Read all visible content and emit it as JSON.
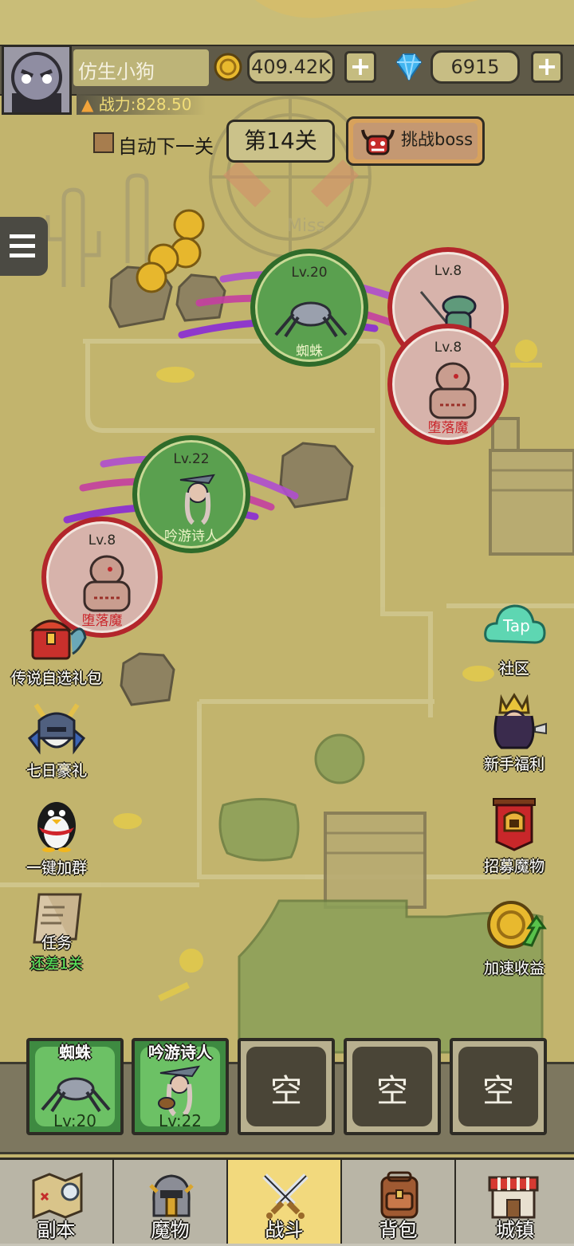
{
  "player": {
    "name": "仿生小狗",
    "gold": "409.42K",
    "gems": "6915",
    "power": "战力:828.50"
  },
  "stage": {
    "auto_next_label": "自动下一关",
    "current": "第14关",
    "boss_button": "挑战boss"
  },
  "battlefield": {
    "watermark": "Miss",
    "monsters": [
      {
        "level": "Lv.20",
        "name": "蜘蛛",
        "side": "ally"
      },
      {
        "level": "Lv.8",
        "name": "",
        "side": "enemy"
      },
      {
        "level": "Lv.8",
        "name": "堕落魔",
        "side": "enemy"
      },
      {
        "level": "Lv.22",
        "name": "吟游诗人",
        "side": "ally"
      },
      {
        "level": "Lv.8",
        "name": "堕落魔",
        "side": "enemy"
      }
    ]
  },
  "left_icons": [
    {
      "label": "传说自选礼包",
      "icon": "treasure-chest-icon"
    },
    {
      "label": "七日豪礼",
      "icon": "knight-helmet-icon"
    },
    {
      "label": "一键加群",
      "icon": "penguin-icon"
    },
    {
      "label": "任务",
      "sub": "还差1关",
      "icon": "scroll-icon"
    }
  ],
  "right_icons": [
    {
      "label": "社区",
      "icon": "taptap-cloud-icon"
    },
    {
      "label": "新手福利",
      "icon": "queen-portrait-icon"
    },
    {
      "label": "招募魔物",
      "icon": "banner-helmet-icon"
    },
    {
      "label": "加速收益",
      "icon": "coin-arrow-icon"
    }
  ],
  "team_slots": [
    {
      "name": "蜘蛛",
      "level": "Lv:20",
      "filled": true
    },
    {
      "name": "吟游诗人",
      "level": "Lv:22",
      "filled": true
    },
    {
      "name": "",
      "empty_label": "空",
      "filled": false
    },
    {
      "name": "",
      "empty_label": "空",
      "filled": false
    },
    {
      "name": "",
      "empty_label": "空",
      "filled": false
    }
  ],
  "bottom_nav": [
    {
      "label": "副本",
      "icon": "map-icon",
      "active": false
    },
    {
      "label": "魔物",
      "icon": "helmet-icon",
      "active": false
    },
    {
      "label": "战斗",
      "icon": "crossed-swords-icon",
      "active": true
    },
    {
      "label": "背包",
      "icon": "backpack-icon",
      "active": false
    },
    {
      "label": "城镇",
      "icon": "shop-icon",
      "active": false
    }
  ],
  "colors": {
    "ally_ring": "#2f6b2a",
    "enemy_ring": "#b3262b",
    "active_tab": "#f2d97d",
    "claw_slash": "#8a2bd6"
  }
}
